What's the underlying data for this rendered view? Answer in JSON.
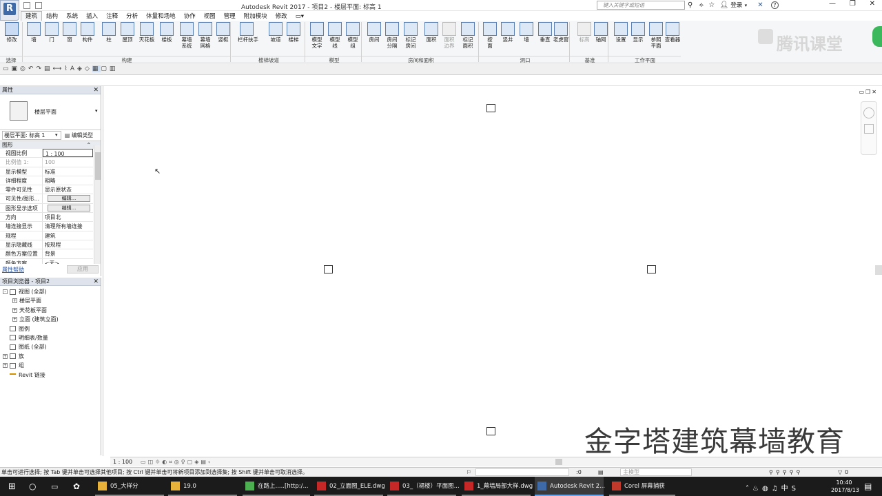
{
  "title_bar": {
    "title": "Autodesk Revit 2017 -     项目2 - 楼层平面: 标高 1",
    "search_placeholder": "键入关键字或短语",
    "login": "登录"
  },
  "tabs": [
    "建筑",
    "结构",
    "系统",
    "插入",
    "注释",
    "分析",
    "体量和场地",
    "协作",
    "视图",
    "管理",
    "附加模块",
    "修改"
  ],
  "active_tab": "建筑",
  "select_label": "选择",
  "ribbon_buttons": [
    {
      "name": "modify",
      "label": "修改"
    },
    {
      "name": "wall",
      "label": "墙"
    },
    {
      "name": "door",
      "label": "门"
    },
    {
      "name": "window",
      "label": "窗"
    },
    {
      "name": "component",
      "label": "构件"
    },
    {
      "name": "column",
      "label": "柱"
    },
    {
      "name": "roof",
      "label": "屋顶"
    },
    {
      "name": "ceiling",
      "label": "天花板"
    },
    {
      "name": "floor",
      "label": "楼板"
    },
    {
      "name": "curtain-system",
      "label": "幕墙\n系统"
    },
    {
      "name": "curtain-grid",
      "label": "幕墙\n网格"
    },
    {
      "name": "mullion",
      "label": "竖梃"
    },
    {
      "name": "railing",
      "label": "栏杆扶手"
    },
    {
      "name": "ramp",
      "label": "坡道"
    },
    {
      "name": "stair",
      "label": "楼梯"
    },
    {
      "name": "model-text",
      "label": "模型\n文字"
    },
    {
      "name": "model-line",
      "label": "模型\n线"
    },
    {
      "name": "model-group",
      "label": "模型\n组"
    },
    {
      "name": "room",
      "label": "房间"
    },
    {
      "name": "room-separator",
      "label": "房间\n分隔"
    },
    {
      "name": "tag-room",
      "label": "标记\n房间"
    },
    {
      "name": "area",
      "label": "面积"
    },
    {
      "name": "area-boundary",
      "label": "面积\n边界"
    },
    {
      "name": "tag-area",
      "label": "标记\n面积"
    },
    {
      "name": "by-face",
      "label": "按\n面"
    },
    {
      "name": "shaft",
      "label": "竖井"
    },
    {
      "name": "opening-wall",
      "label": "墙"
    },
    {
      "name": "vertical",
      "label": "垂直"
    },
    {
      "name": "dormer",
      "label": "老虎窗"
    },
    {
      "name": "level",
      "label": "标高"
    },
    {
      "name": "grid",
      "label": "轴网"
    },
    {
      "name": "set",
      "label": "设置"
    },
    {
      "name": "show",
      "label": "显示"
    },
    {
      "name": "ref-plane",
      "label": "参照\n平面"
    },
    {
      "name": "viewer",
      "label": "查看器"
    }
  ],
  "panels": [
    "构建",
    "楼梯坡道",
    "模型",
    "房间和面积",
    "洞口",
    "基准",
    "工作平面"
  ],
  "watermark_top": "腾讯课堂",
  "properties": {
    "title": "属性",
    "type_name": "楼层平面",
    "selector": "楼层平面: 标高 1",
    "edit_type": "编辑类型",
    "group": "图形",
    "rows": [
      {
        "k": "视图比例",
        "v": "1 : 100"
      },
      {
        "k": "比例值 1:",
        "v": "100"
      },
      {
        "k": "显示模型",
        "v": "标准"
      },
      {
        "k": "详细程度",
        "v": "粗略"
      },
      {
        "k": "零件可见性",
        "v": "显示原状态"
      },
      {
        "k": "可见性/图形...",
        "v": "编辑..."
      },
      {
        "k": "图形显示选项",
        "v": "编辑..."
      },
      {
        "k": "方向",
        "v": "项目北"
      },
      {
        "k": "墙连接显示",
        "v": "清理所有墙连接"
      },
      {
        "k": "规程",
        "v": "建筑"
      },
      {
        "k": "显示隐藏线",
        "v": "按规程"
      },
      {
        "k": "颜色方案位置",
        "v": "背景"
      },
      {
        "k": "颜色方案",
        "v": "<无>"
      }
    ],
    "help": "属性帮助",
    "apply": "应用"
  },
  "browser": {
    "title": "项目浏览器 - 项目2",
    "nodes": [
      {
        "label": "视图 (全部)",
        "level": 0,
        "exp": "-"
      },
      {
        "label": "楼层平面",
        "level": 1,
        "exp": "+"
      },
      {
        "label": "天花板平面",
        "level": 1,
        "exp": "+"
      },
      {
        "label": "立面 (建筑立面)",
        "level": 1,
        "exp": "+"
      },
      {
        "label": "图例",
        "level": 0,
        "exp": ""
      },
      {
        "label": "明细表/数量",
        "level": 0,
        "exp": ""
      },
      {
        "label": "图纸 (全部)",
        "level": 0,
        "exp": ""
      },
      {
        "label": "族",
        "level": 0,
        "exp": "+"
      },
      {
        "label": "组",
        "level": 0,
        "exp": "+"
      },
      {
        "label": "Revit 链接",
        "level": 0,
        "exp": ""
      }
    ]
  },
  "watermark_bottom": "金字塔建筑幕墙教育",
  "view_scale": "1 : 100",
  "status_text": "单击可进行选择; 按 Tab 键并单击可选择其他项目; 按 Ctrl 键并单击可将新项目添加到选择集; 按 Shift 键并单击可取消选择。",
  "status_right": {
    "count": ":0",
    "model": "主模型",
    "filter": "0"
  },
  "taskbar": {
    "items": [
      {
        "label": "05_大样分",
        "name": "task-folder-05"
      },
      {
        "label": "19.0",
        "name": "task-folder-19"
      },
      {
        "label": "在路上.....[http:/...",
        "name": "task-chrome"
      },
      {
        "label": "02_立面图_ELE.dwg",
        "name": "task-dwg-02"
      },
      {
        "label": "03_（裙楼）平面图...",
        "name": "task-dwg-03"
      },
      {
        "label": "1_幕墙局部大样.dwg",
        "name": "task-dwg-1"
      },
      {
        "label": "Autodesk Revit 2...",
        "name": "task-revit"
      },
      {
        "label": "Corel 屏幕捕获",
        "name": "task-corel"
      }
    ],
    "time": "10:40",
    "date": "2017/8/13"
  }
}
